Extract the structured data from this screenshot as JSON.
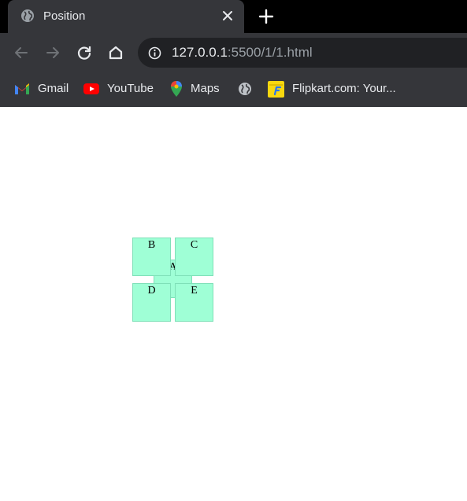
{
  "browser": {
    "tab": {
      "title": "Position"
    },
    "address_bar": {
      "url_host": "127.0.0.1",
      "url_path": ":5500/1/1.html"
    },
    "bookmarks": [
      {
        "label": "Gmail",
        "icon": "gmail-icon"
      },
      {
        "label": "YouTube",
        "icon": "youtube-icon"
      },
      {
        "label": "Maps",
        "icon": "maps-icon"
      },
      {
        "label": "",
        "icon": "globe-icon"
      },
      {
        "label": "Flipkart.com: Your...",
        "icon": "flipkart-icon"
      }
    ]
  },
  "page": {
    "boxes": {
      "a": "A",
      "b": "B",
      "c": "C",
      "d": "D",
      "e": "E"
    }
  },
  "colors": {
    "chrome_dark": "#35363a",
    "tabstrip": "#000000",
    "omnibox": "#202124",
    "box_fill": "#9fffd6"
  }
}
